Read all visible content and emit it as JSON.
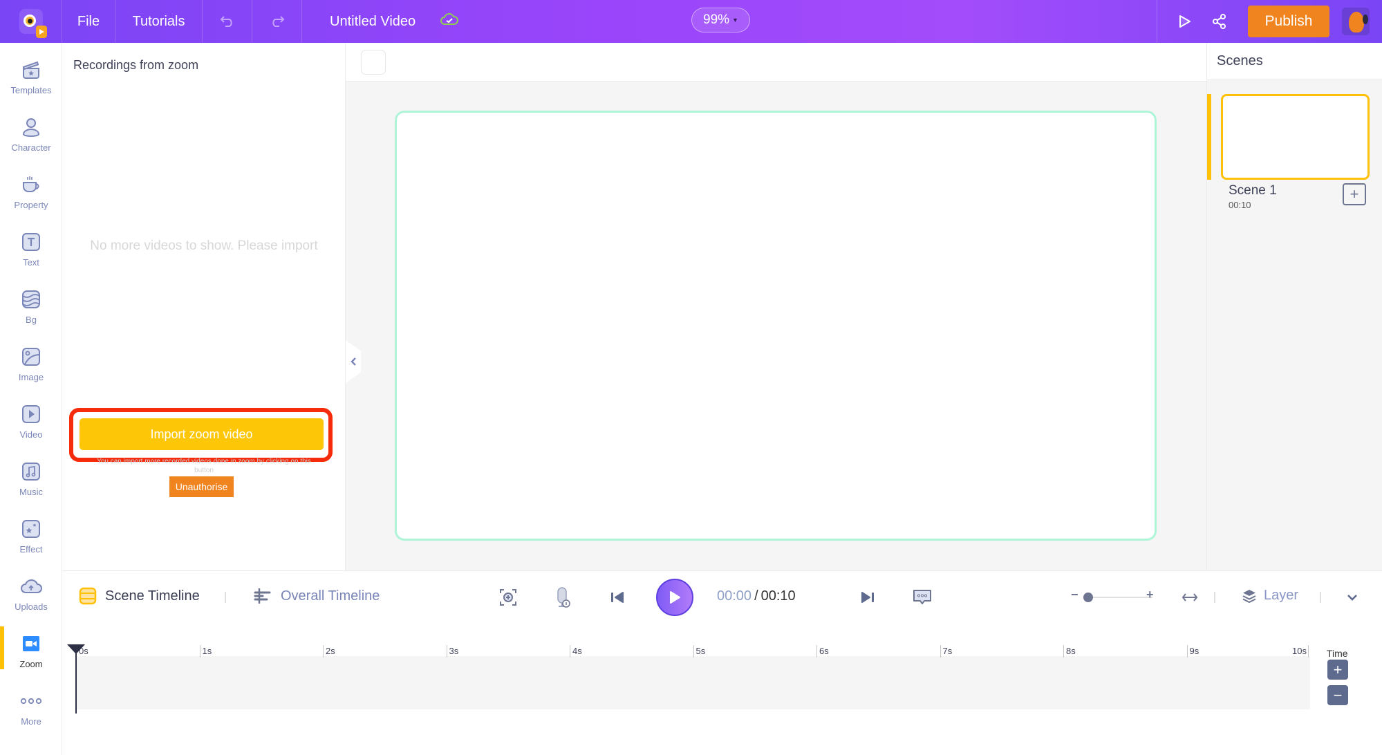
{
  "header": {
    "menu_file": "File",
    "menu_tutorials": "Tutorials",
    "video_title": "Untitled Video",
    "zoom_level": "99%",
    "publish_label": "Publish",
    "icons": {
      "undo": "undo-icon",
      "redo": "redo-icon",
      "cloud_saved": "cloud-check-icon",
      "preview": "play-outline-icon",
      "share": "share-icon"
    }
  },
  "sidebar": {
    "items": [
      {
        "label": "Templates",
        "icon": "clapperboard-icon"
      },
      {
        "label": "Character",
        "icon": "person-icon"
      },
      {
        "label": "Property",
        "icon": "cup-icon"
      },
      {
        "label": "Text",
        "icon": "text-icon"
      },
      {
        "label": "Bg",
        "icon": "background-icon"
      },
      {
        "label": "Image",
        "icon": "image-icon"
      },
      {
        "label": "Video",
        "icon": "video-icon"
      },
      {
        "label": "Music",
        "icon": "music-icon"
      },
      {
        "label": "Effect",
        "icon": "effect-icon"
      },
      {
        "label": "Uploads",
        "icon": "upload-cloud-icon"
      },
      {
        "label": "Zoom",
        "icon": "zoom-camera-icon",
        "active": true
      },
      {
        "label": "More",
        "icon": "more-dots-icon"
      }
    ]
  },
  "left_panel": {
    "title": "Recordings from zoom",
    "empty_message": "No more videos to show. Please import",
    "import_button": "Import zoom video",
    "import_hint": "You can import more recorded videos done in zoom by clicking on this button",
    "unauthorise_button": "Unauthorise"
  },
  "scenes_panel": {
    "title": "Scenes",
    "scenes": [
      {
        "name": "Scene 1",
        "duration": "00:10",
        "selected": true
      }
    ]
  },
  "timeline": {
    "scene_tab": "Scene Timeline",
    "overall_tab": "Overall Timeline",
    "current_time": "00:00",
    "separator": "/",
    "total_time": "00:10",
    "layer_label": "Layer",
    "zoom_slider_value": 0,
    "ruler_ticks": [
      "0s",
      "1s",
      "2s",
      "3s",
      "4s",
      "5s",
      "6s",
      "7s",
      "8s",
      "9s",
      "10s"
    ],
    "time_label": "Time",
    "time_zoom_in": "+",
    "time_zoom_out": "−"
  },
  "colors": {
    "header_gradient_start": "#7a45f5",
    "header_gradient_mid": "#a24cfb",
    "publish": "#f0841f",
    "import_button": "#fdc607",
    "highlight_outline": "#f52b0b",
    "active_accent": "#ffc107",
    "canvas_border": "#aef5d8",
    "icon_muted": "#7b86b8"
  }
}
